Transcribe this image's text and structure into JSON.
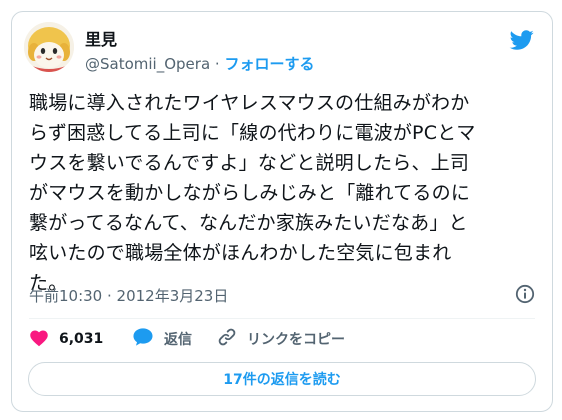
{
  "author": {
    "name": "里見",
    "handle": "@Satomii_Opera",
    "separator": "·",
    "follow_label": "フォローする"
  },
  "tweet": {
    "lines": [
      "職場に導入されたワイヤレスマウスの仕組みがわか",
      "らず困惑してる上司に「線の代わりに電波がPCとマ",
      "ウスを繋いでるんですよ」などと説明したら、上司",
      "がマウスを動かしながらしみじみと「離れてるのに",
      "繋がってるなんて、なんだか家族みたいだなあ」と",
      "呟いたので職場全体がほんわかした空気に包まれ",
      "た。"
    ],
    "timestamp": "午前10:30 · 2012年3月23日"
  },
  "actions": {
    "like_count": "6,031",
    "reply_label": "返信",
    "copy_link_label": "リンクをコピー",
    "read_replies_label": "17件の返信を読む"
  },
  "icons": {
    "logo": "twitter-bird-icon",
    "info": "info-icon",
    "like": "heart-icon",
    "reply": "speech-bubble-icon",
    "link": "link-icon"
  },
  "colors": {
    "accent": "#1d9bf0",
    "like": "#f91880",
    "text": "#0f1419",
    "secondary_text": "#536471",
    "border": "#cfd9de"
  }
}
